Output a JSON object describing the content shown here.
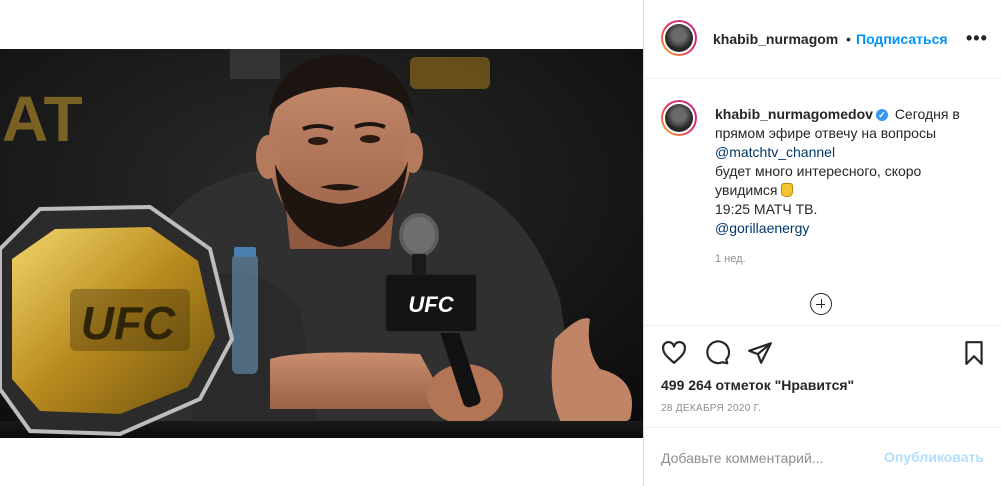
{
  "post": {
    "header": {
      "username": "khabib_nurmagom",
      "separator": "•",
      "follow_label": "Подписаться",
      "more_label": "•••"
    },
    "caption": {
      "username": "khabib_nurmagomedov",
      "line1": "Сегодня в прямом эфире отвечу на вопросы",
      "mention1": "@matchtv_channel",
      "line2": "будет много интересного, скоро увидимся",
      "line3": "19:25 МАТЧ ТВ.",
      "mention2": "@gorillaenergy",
      "age": "1 нед."
    },
    "likes": "499 264 отметок \"Нравится\"",
    "date": "28 ДЕКАБРЯ 2020 Г.",
    "comment": {
      "placeholder": "Добавьте комментарий...",
      "value": "",
      "post_label": "Опубликовать"
    },
    "image": {
      "belt_text": "UFC",
      "mic_text": "UFC"
    }
  },
  "icons": {
    "verified": "verified-badge-icon",
    "like": "heart-icon",
    "comment": "comment-bubble-icon",
    "share": "paper-plane-icon",
    "save": "bookmark-icon",
    "more_comments": "plus-circle-icon"
  },
  "colors": {
    "accent": "#0095f6",
    "post_disabled": "#b2dffc",
    "mention": "#00376b",
    "muted": "#8e8e8e",
    "text": "#262626"
  }
}
